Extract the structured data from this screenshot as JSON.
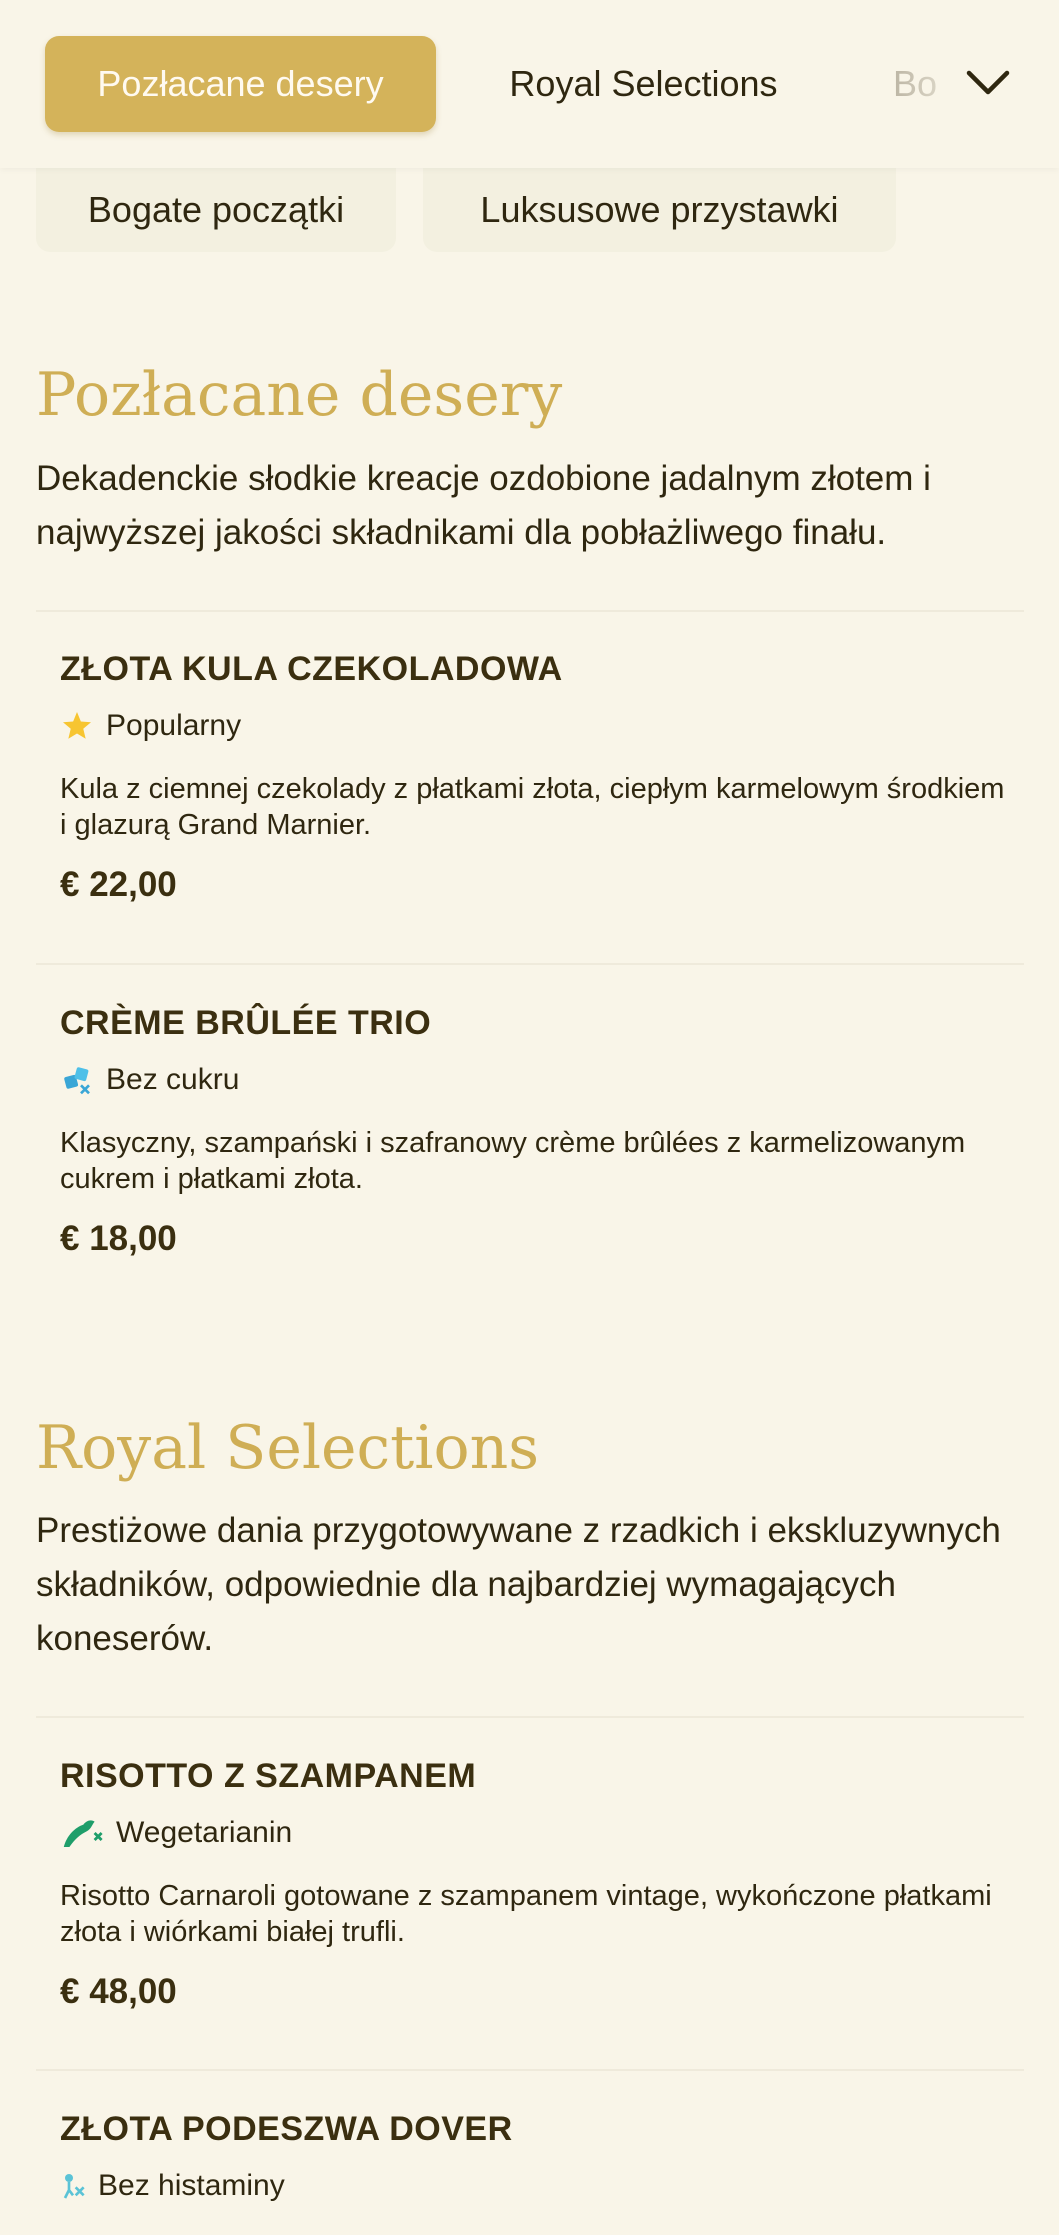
{
  "nav": {
    "tabs": [
      {
        "label": "Pozłacane desery",
        "active": true
      },
      {
        "label": "Royal Selections",
        "active": false
      },
      {
        "label": "Bo",
        "active": false
      }
    ],
    "chips": [
      "Bogate początki",
      "Luksusowe przystawki"
    ]
  },
  "colors": {
    "accent": "#d4b35a",
    "title": "#cfae55",
    "background": "#f9f5e8",
    "text": "#2f2710"
  },
  "sections": [
    {
      "title": "Pozłacane desery",
      "description": "Dekadenckie słodkie kreacje ozdobione jadalnym złotem i najwyższej jakości składnikami dla pobłażliwego finału.",
      "items": [
        {
          "name": "ZŁOTA KULA CZEKOLADOWA",
          "tag": "Popularny",
          "tag_icon": "star-icon",
          "description": "Kula z ciemnej czekolady z płatkami złota, ciepłym karmelowym środkiem i glazurą Grand Marnier.",
          "price": "€ 22,00"
        },
        {
          "name": "CRÈME BRÛLÉE TRIO",
          "tag": "Bez cukru",
          "tag_icon": "sugar-free-icon",
          "description": "Klasyczny, szampański i szafranowy crème brûlées z karmelizowanym cukrem i płatkami złota.",
          "price": "€ 18,00"
        }
      ]
    },
    {
      "title": "Royal Selections",
      "description": "Prestiżowe dania przygotowywane z rzadkich i ekskluzywnych składników, odpowiednie dla najbardziej wymagających koneserów.",
      "items": [
        {
          "name": "RISOTTO Z SZAMPANEM",
          "tag": "Wegetarianin",
          "tag_icon": "vegetarian-icon",
          "description": "Risotto Carnaroli gotowane z szampanem vintage, wykończone płatkami złota i wiórkami białej trufli.",
          "price": "€ 48,00"
        },
        {
          "name": "ZŁOTA PODESZWA DOVER",
          "tag": "Bez histaminy",
          "tag_icon": "histamine-free-icon"
        }
      ]
    }
  ]
}
